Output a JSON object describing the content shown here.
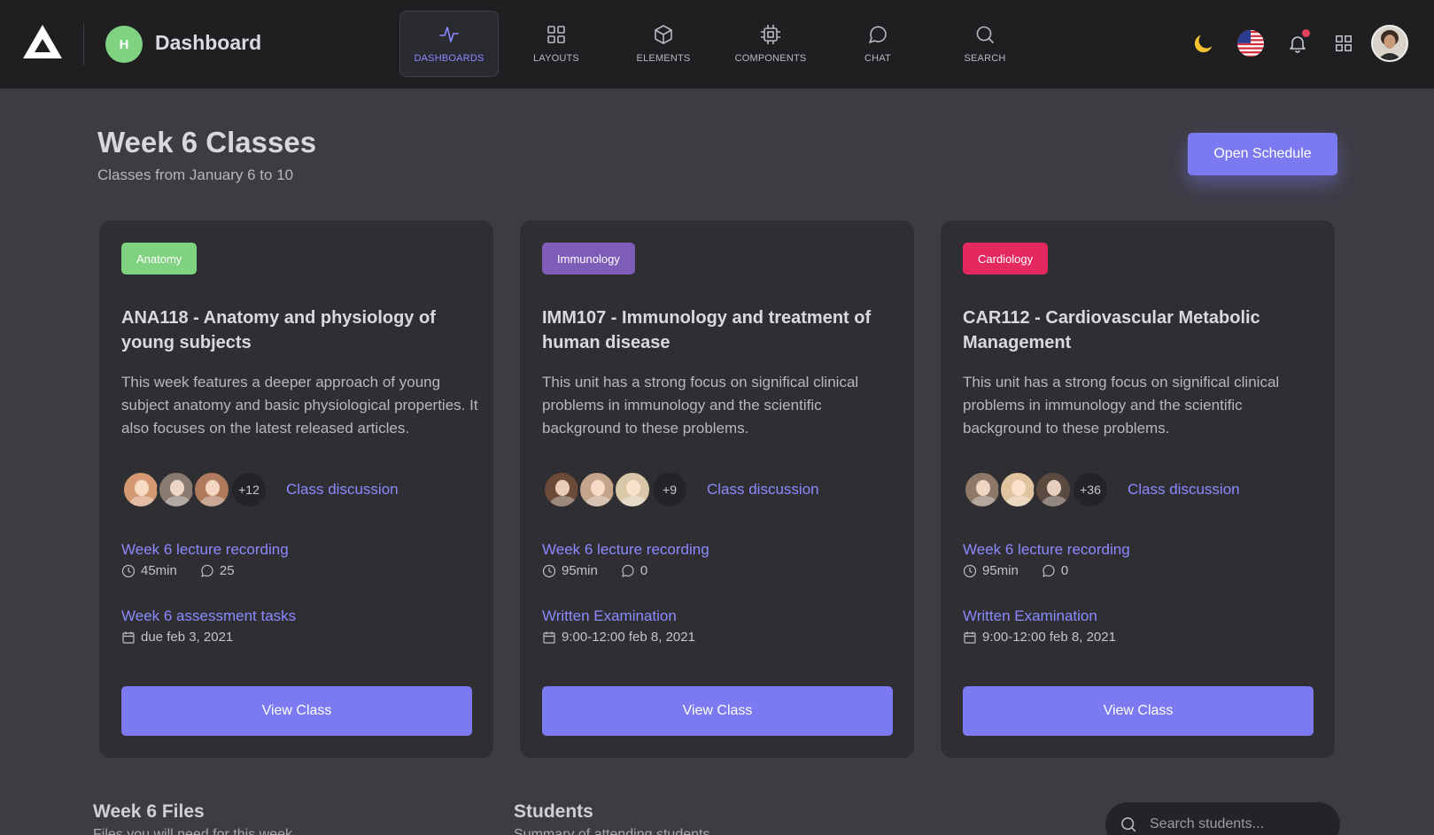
{
  "header": {
    "brand_initial": "H",
    "brand_title": "Dashboard",
    "nav": [
      {
        "label": "DASHBOARDS",
        "icon": "activity-icon",
        "active": true
      },
      {
        "label": "LAYOUTS",
        "icon": "grid-icon"
      },
      {
        "label": "ELEMENTS",
        "icon": "cube-icon"
      },
      {
        "label": "COMPONENTS",
        "icon": "cpu-icon"
      },
      {
        "label": "CHAT",
        "icon": "chat-bubble-icon"
      },
      {
        "label": "SEARCH",
        "icon": "search-icon"
      }
    ],
    "utility_icons": [
      "moon-icon",
      "us-flag-icon",
      "bell-icon",
      "apps-grid-icon",
      "user-avatar"
    ]
  },
  "page": {
    "title": "Week 6 Classes",
    "subtitle": "Classes from January 6 to 10",
    "open_schedule_label": "Open Schedule"
  },
  "cards": [
    {
      "tag": "Anatomy",
      "tag_color": "#7fd27f",
      "title": "ANA118 - Anatomy and physiology of young subjects",
      "description": "This week features a deeper approach of young subject anatomy and basic physiological properties. It also focuses on the latest released articles.",
      "more_count": "+12",
      "discussion_label": "Class discussion",
      "resource1": {
        "title": "Week 6 lecture recording",
        "duration": "45min",
        "comments": "25"
      },
      "resource2": {
        "title": "Week 6 assessment tasks",
        "date": "due feb 3, 2021"
      },
      "button_label": "View Class"
    },
    {
      "tag": "Immunology",
      "tag_color": "#7d5db8",
      "title": "IMM107 - Immunology and treatment of human disease",
      "description": "This unit has a strong focus on significal clinical problems in immunology and the scientific background to these problems.",
      "more_count": "+9",
      "discussion_label": "Class discussion",
      "resource1": {
        "title": "Week 6 lecture recording",
        "duration": "95min",
        "comments": "0"
      },
      "resource2": {
        "title": "Written Examination",
        "date": "9:00-12:00 feb 8, 2021"
      },
      "button_label": "View Class"
    },
    {
      "tag": "Cardiology",
      "tag_color": "#e3295f",
      "title": "CAR112 - Cardiovascular Metabolic Management",
      "description": "This unit has a strong focus on significal clinical problems in immunology and the scientific background to these problems.",
      "more_count": "+36",
      "discussion_label": "Class discussion",
      "resource1": {
        "title": "Week 6 lecture recording",
        "duration": "95min",
        "comments": "0"
      },
      "resource2": {
        "title": "Written Examination",
        "date": "9:00-12:00 feb 8, 2021"
      },
      "button_label": "View Class"
    }
  ],
  "sections": {
    "files_title": "Week 6 Files",
    "files_subtitle": "Files you will need for this week",
    "students_title": "Students",
    "students_subtitle": "Summary of attending students",
    "search_placeholder": "Search students..."
  },
  "colors": {
    "accent": "#7b7af0",
    "link": "#8b8aff",
    "background": "#3d3c43",
    "topbar": "#1f1f22",
    "card": "#2e2e33"
  }
}
